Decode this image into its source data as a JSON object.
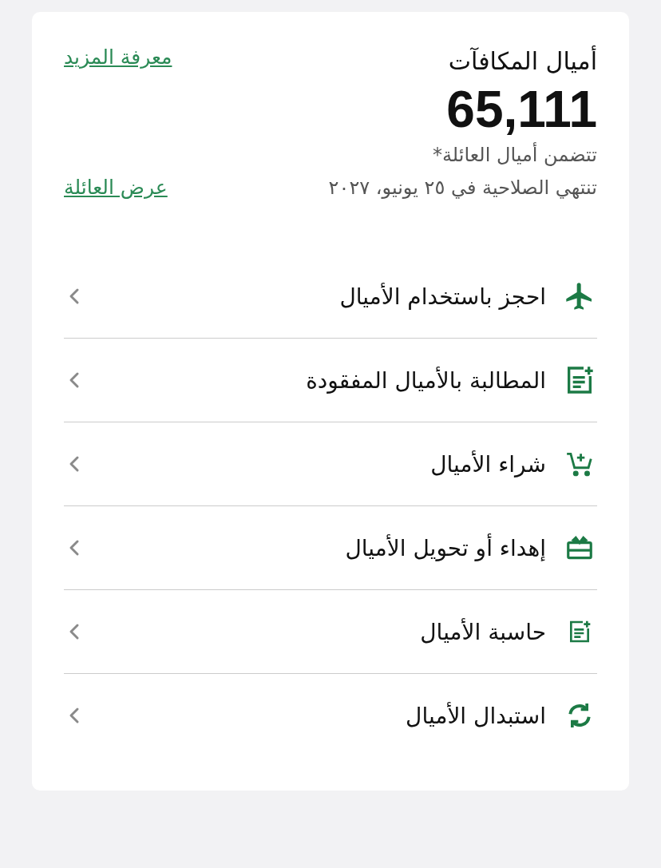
{
  "rewards": {
    "title": "أميال المكافآت",
    "learn_more_link": "معرفة المزيد",
    "balance": "65,111",
    "family_note": "تتضمن أميال العائلة*",
    "expiry": "تنتهي الصلاحية في  ٢٥ يونيو، ٢٠٢٧",
    "view_family_link": "عرض العائلة"
  },
  "menu": [
    {
      "label": "احجز باستخدام الأميال",
      "kind": "plane"
    },
    {
      "label": "المطالبة بالأميال المفقودة",
      "kind": "claim"
    },
    {
      "label": "شراء الأميال",
      "kind": "buy"
    },
    {
      "label": "إهداء أو تحويل الأميال",
      "kind": "gift"
    },
    {
      "label": "حاسبة الأميال",
      "kind": "calculator"
    },
    {
      "label": "استبدال الأميال",
      "kind": "redeem"
    }
  ]
}
